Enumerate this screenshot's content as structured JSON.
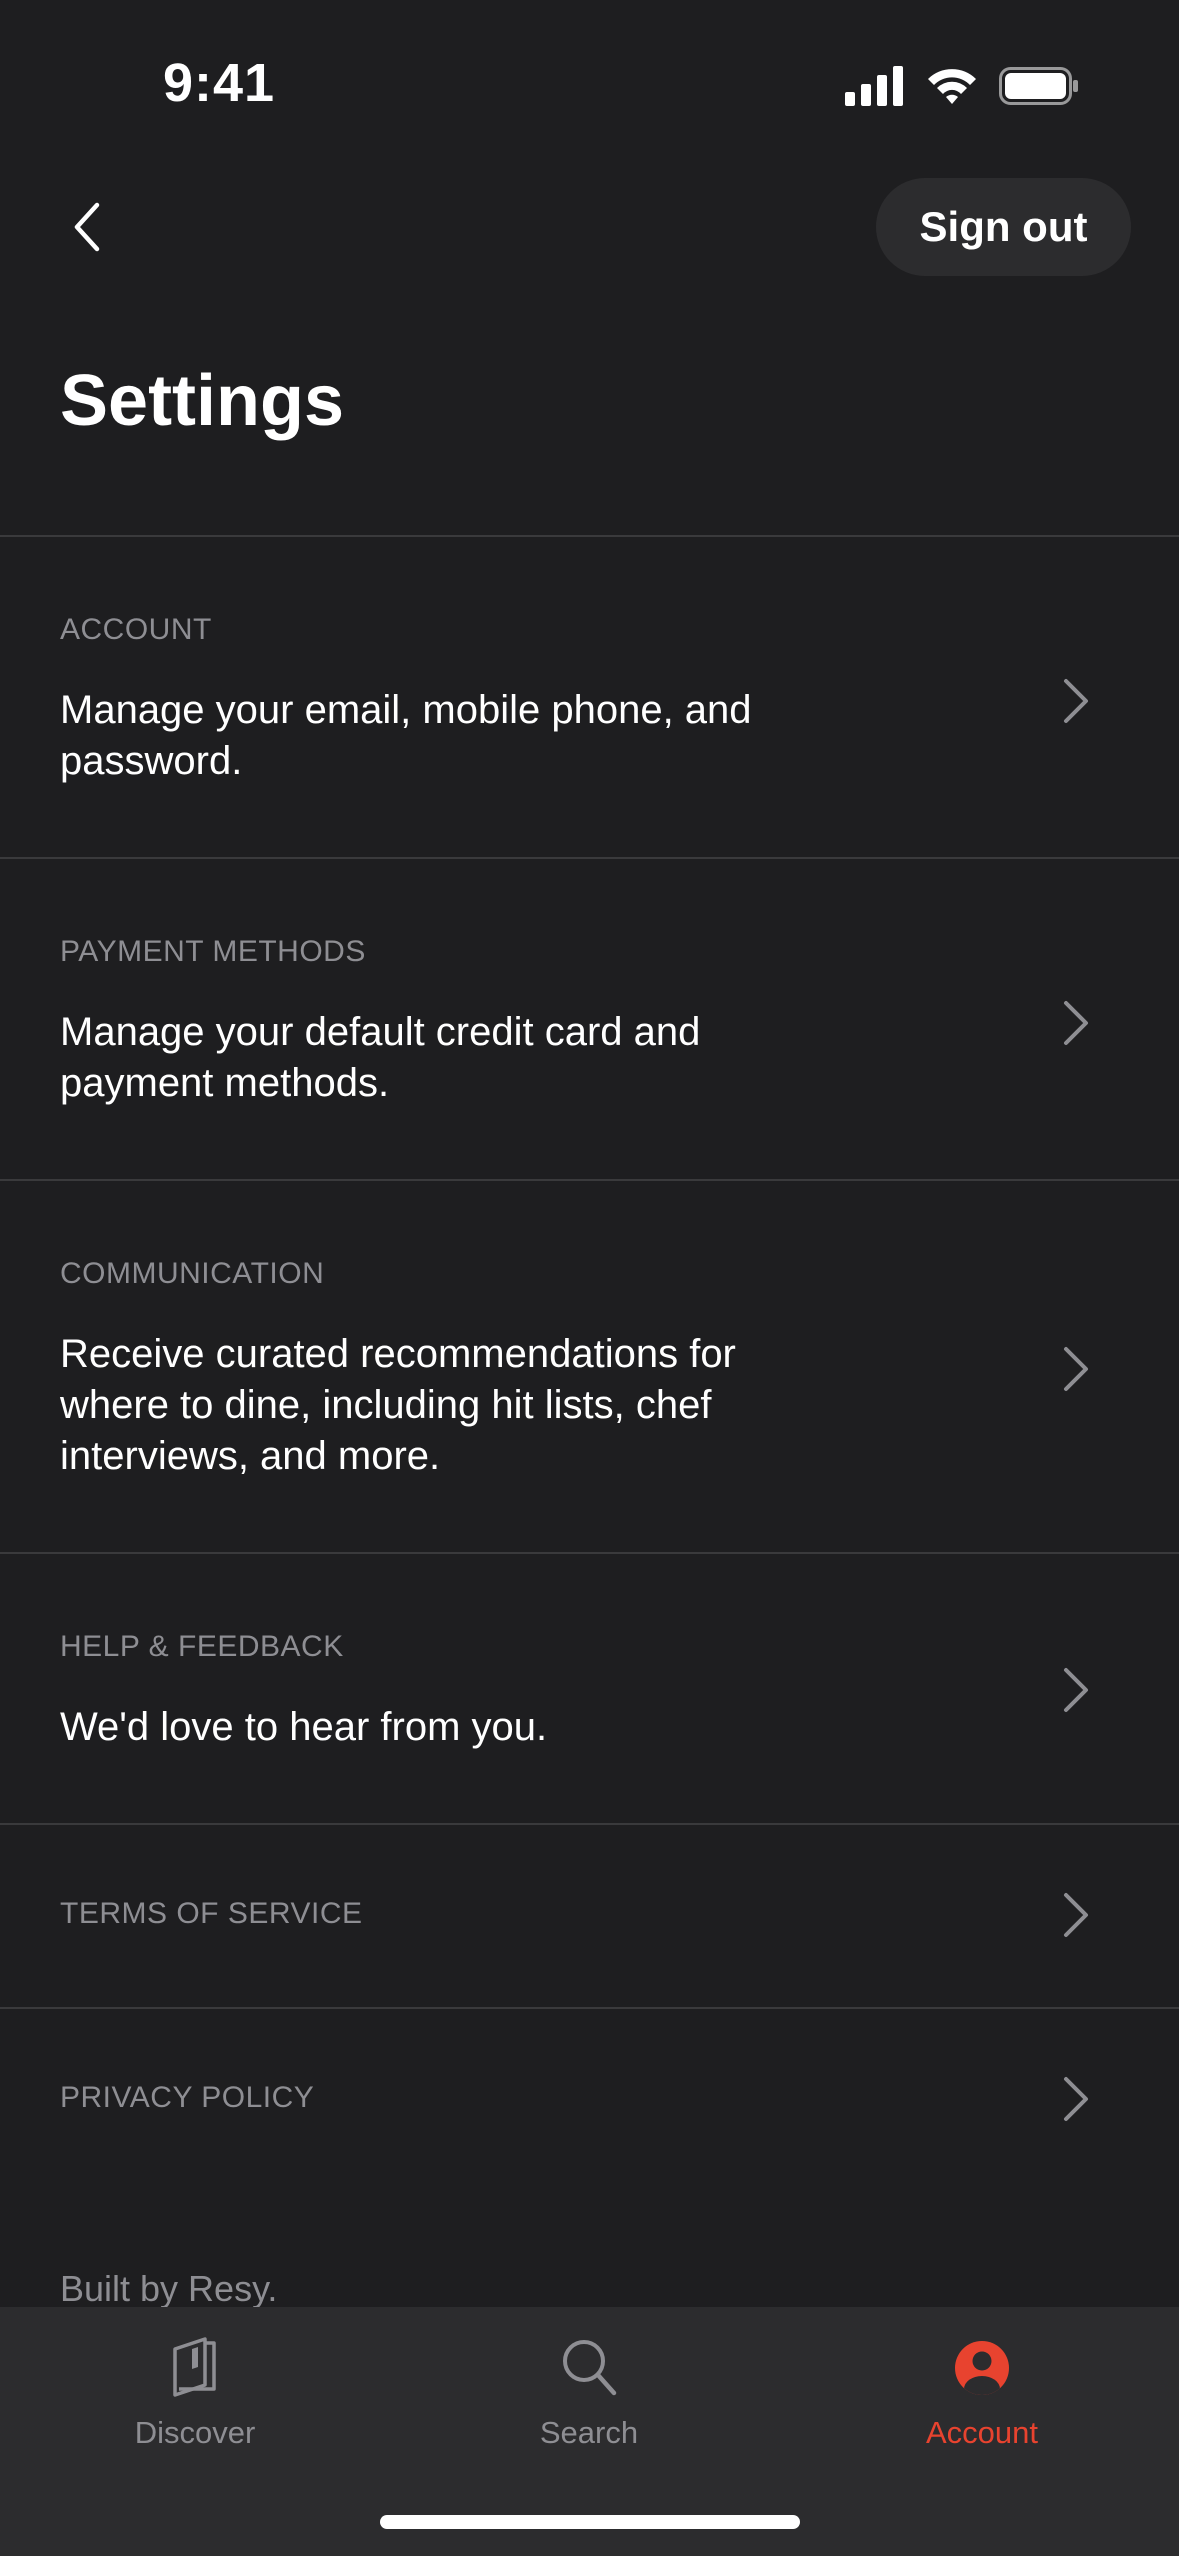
{
  "status_bar": {
    "time": "9:41"
  },
  "header": {
    "sign_out_label": "Sign out",
    "title": "Settings"
  },
  "settings": [
    {
      "label": "ACCOUNT",
      "description": "Manage your email, mobile phone, and password."
    },
    {
      "label": "PAYMENT METHODS",
      "description": "Manage your default credit card and payment methods."
    },
    {
      "label": "COMMUNICATION",
      "description": "Receive curated recommendations for where to dine, including hit lists, chef interviews, and more."
    },
    {
      "label": "HELP & FEEDBACK",
      "description": "We'd love to hear from you."
    },
    {
      "label": "TERMS OF SERVICE"
    },
    {
      "label": "PRIVACY POLICY"
    }
  ],
  "footer": {
    "text": "Built by Resy."
  },
  "tab_bar": {
    "tabs": [
      {
        "label": "Discover",
        "icon": "book-icon"
      },
      {
        "label": "Search",
        "icon": "search-icon"
      },
      {
        "label": "Account",
        "icon": "person-circle-icon",
        "active": true
      }
    ],
    "active_color": "#e8432f",
    "inactive_color": "#8e8e93"
  }
}
